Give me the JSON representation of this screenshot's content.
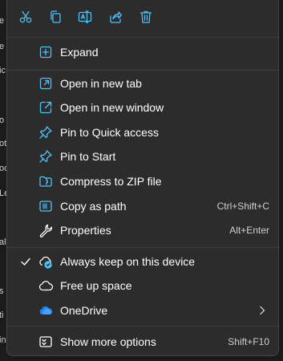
{
  "background_fragments": [
    "e",
    "e",
    "ic",
    "o",
    "ot",
    "oc",
    "Le",
    "al",
    "s",
    "ti",
    "in"
  ],
  "toolbar": {
    "buttons": [
      {
        "name": "cut-button",
        "icon": "scissors-icon"
      },
      {
        "name": "copy-button",
        "icon": "copy-icon"
      },
      {
        "name": "rename-button",
        "icon": "rename-icon"
      },
      {
        "name": "share-button",
        "icon": "share-icon"
      },
      {
        "name": "delete-button",
        "icon": "trash-icon"
      }
    ]
  },
  "menu": {
    "expand": {
      "label": "Expand",
      "icon": "expand-icon"
    },
    "open_new_tab": {
      "label": "Open in new tab",
      "icon": "new-tab-icon"
    },
    "open_new_window": {
      "label": "Open in new window",
      "icon": "new-window-icon"
    },
    "pin_quick_access": {
      "label": "Pin to Quick access",
      "icon": "pin-icon"
    },
    "pin_start": {
      "label": "Pin to Start",
      "icon": "pin-icon"
    },
    "compress_zip": {
      "label": "Compress to ZIP file",
      "icon": "zip-icon"
    },
    "copy_path": {
      "label": "Copy as path",
      "shortcut": "Ctrl+Shift+C",
      "icon": "copy-path-icon"
    },
    "properties": {
      "label": "Properties",
      "shortcut": "Alt+Enter",
      "icon": "wrench-icon"
    },
    "always_keep": {
      "label": "Always keep on this device",
      "checked": true,
      "icon": "cloud-sync-icon"
    },
    "free_space": {
      "label": "Free up space",
      "icon": "cloud-icon"
    },
    "onedrive": {
      "label": "OneDrive",
      "has_submenu": true,
      "icon": "onedrive-icon"
    },
    "more_options": {
      "label": "Show more options",
      "shortcut": "Shift+F10",
      "icon": "more-options-icon"
    }
  },
  "colors": {
    "menu_bg": "#2c2c2c",
    "accent_blue": "#4cc2ff",
    "onedrive_blue": "#1d83ff",
    "separator": "#3f3f3f"
  }
}
